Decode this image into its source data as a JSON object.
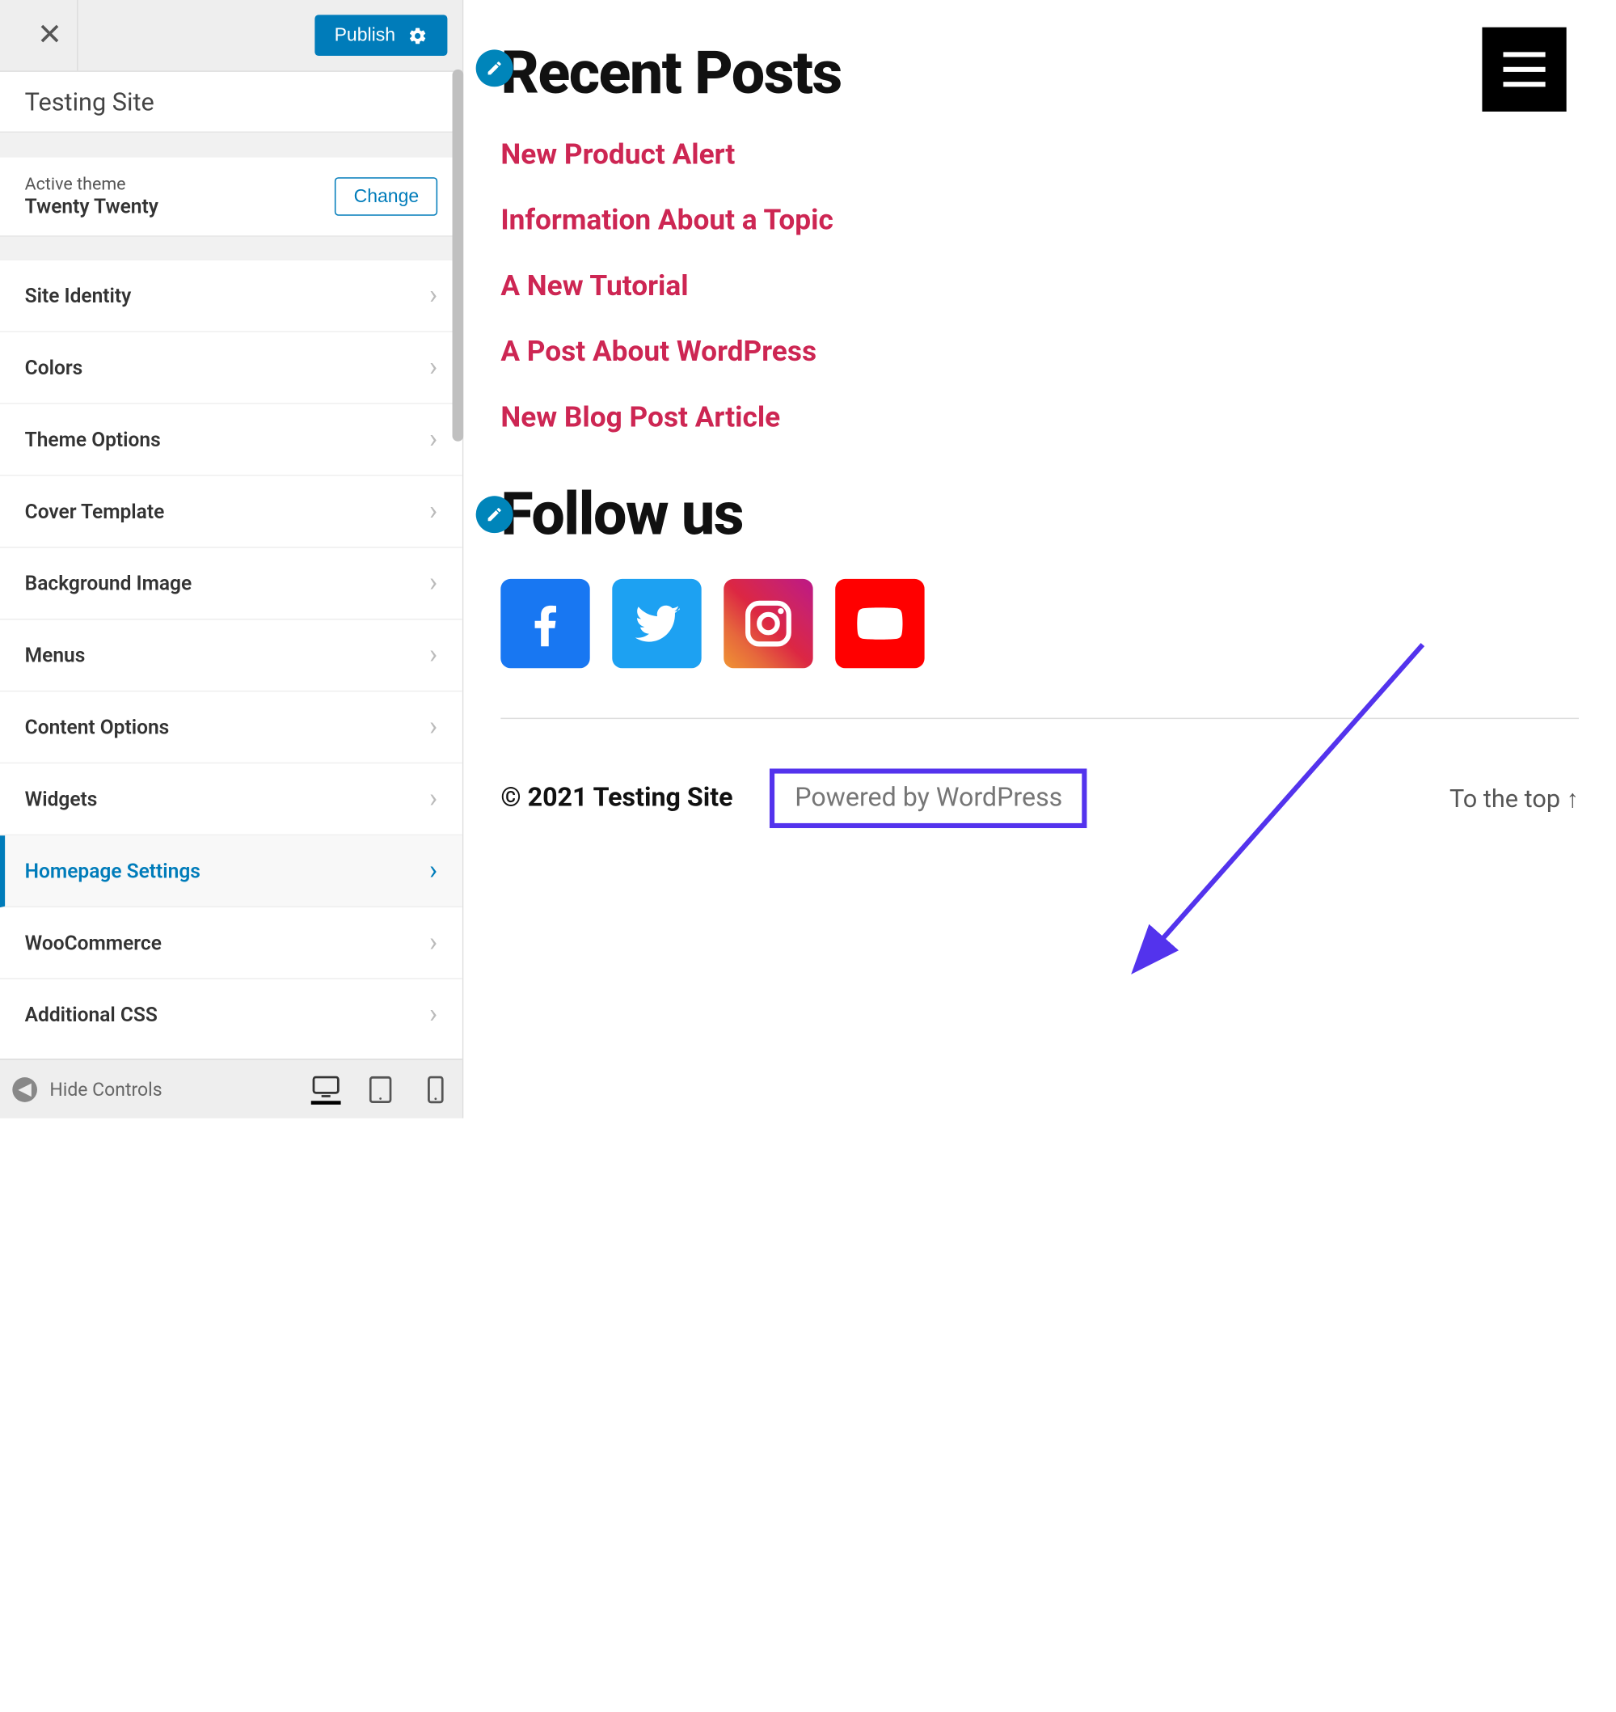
{
  "sidebar": {
    "close_label": "✕",
    "publish_label": "Publish",
    "site_title": "Testing Site",
    "active_theme_label": "Active theme",
    "active_theme_name": "Twenty Twenty",
    "change_label": "Change",
    "hide_controls_label": "Hide Controls",
    "items": [
      {
        "label": "Site Identity",
        "active": false
      },
      {
        "label": "Colors",
        "active": false
      },
      {
        "label": "Theme Options",
        "active": false
      },
      {
        "label": "Cover Template",
        "active": false
      },
      {
        "label": "Background Image",
        "active": false
      },
      {
        "label": "Menus",
        "active": false
      },
      {
        "label": "Content Options",
        "active": false
      },
      {
        "label": "Widgets",
        "active": false
      },
      {
        "label": "Homepage Settings",
        "active": true
      },
      {
        "label": "WooCommerce",
        "active": false
      },
      {
        "label": "Additional CSS",
        "active": false
      }
    ]
  },
  "preview": {
    "recent_posts": {
      "title": "Recent Posts",
      "items": [
        "New Product Alert",
        "Information About a Topic",
        "A New Tutorial",
        "A Post About WordPress",
        "New Blog Post Article"
      ]
    },
    "follow_us": {
      "title": "Follow us",
      "socials": [
        "facebook",
        "twitter",
        "instagram",
        "youtube"
      ]
    },
    "footer": {
      "copyright": "© 2021 Testing Site",
      "powered": "Powered by WordPress",
      "to_top": "To the top ↑"
    }
  }
}
